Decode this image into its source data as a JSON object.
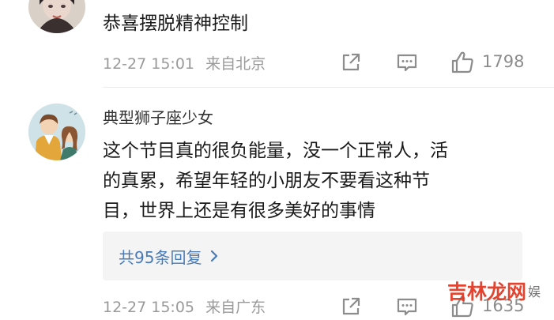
{
  "comment_top": {
    "text": "恭喜摆脱精神控制",
    "time": "12-27 15:01",
    "location": "来自北京",
    "likes": "1798",
    "share_icon": "share-icon",
    "comment_icon": "comment-icon",
    "like_icon": "thumbs-up-icon"
  },
  "comment_main": {
    "username": "典型狮子座少女",
    "lines": [
      "这个节目真的很负能量，没一个正常人，活",
      "的真累，希望年轻的小朋友不要看这种节",
      "目，世界上还是有很多美好的事情"
    ],
    "replies_label": "共95条回复",
    "time": "12-27 15:05",
    "location": "来自广东",
    "likes": "1635"
  },
  "watermark": {
    "text": "吉林龙网",
    "suffix": "娱"
  },
  "colors": {
    "link": "#4a7bb7",
    "meta": "#9a9a9a",
    "icon": "#8c8c8c",
    "watermark": "#e1341e"
  }
}
